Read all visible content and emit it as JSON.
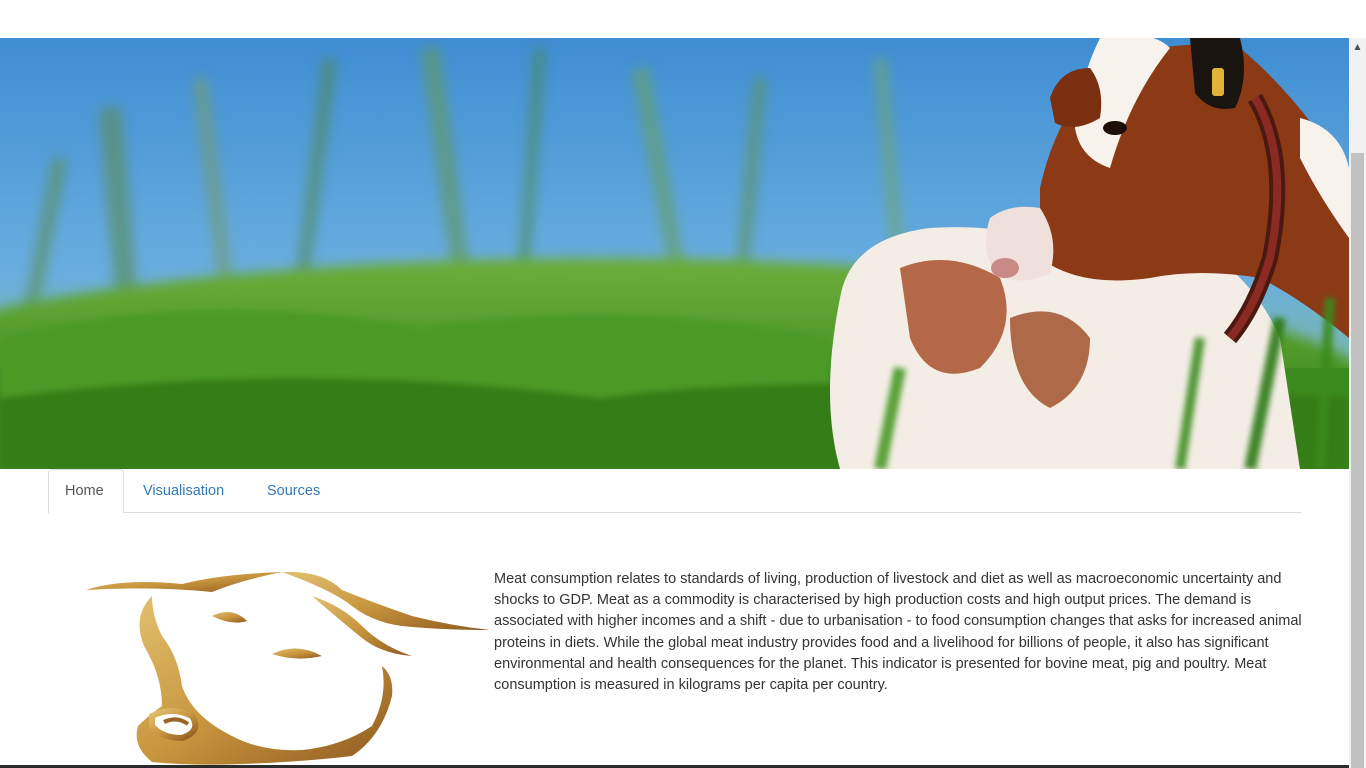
{
  "tabs": [
    {
      "label": "Home",
      "active": true
    },
    {
      "label": "Visualisation",
      "active": false
    },
    {
      "label": "Sources",
      "active": false
    }
  ],
  "intro_text": "Meat consumption relates to standards of living, production of livestock and diet as well as macroeconomic uncertainty and shocks to GDP. Meat as a commodity is characterised by high production costs and high output prices. The demand is associated with higher incomes and a shift - due to urbanisation - to food consumption changes that asks for increased animal proteins in diets. While the global meat industry provides food and a livelihood for billions of people, it also has significant environmental and health consequences for the planet. This indicator is presented for bovine meat, pig and poultry. Meat consumption is measured in kilograms per capita per country.",
  "colors": {
    "link": "#337ab7",
    "active_tab_text": "#555555",
    "body_text": "#333333",
    "sky": "#4a95d4",
    "grass": "#3f8f22",
    "cow_brown": "#8b3a15",
    "logo_gold": "#c8963e"
  },
  "icons": {
    "scroll_up": "▲"
  }
}
